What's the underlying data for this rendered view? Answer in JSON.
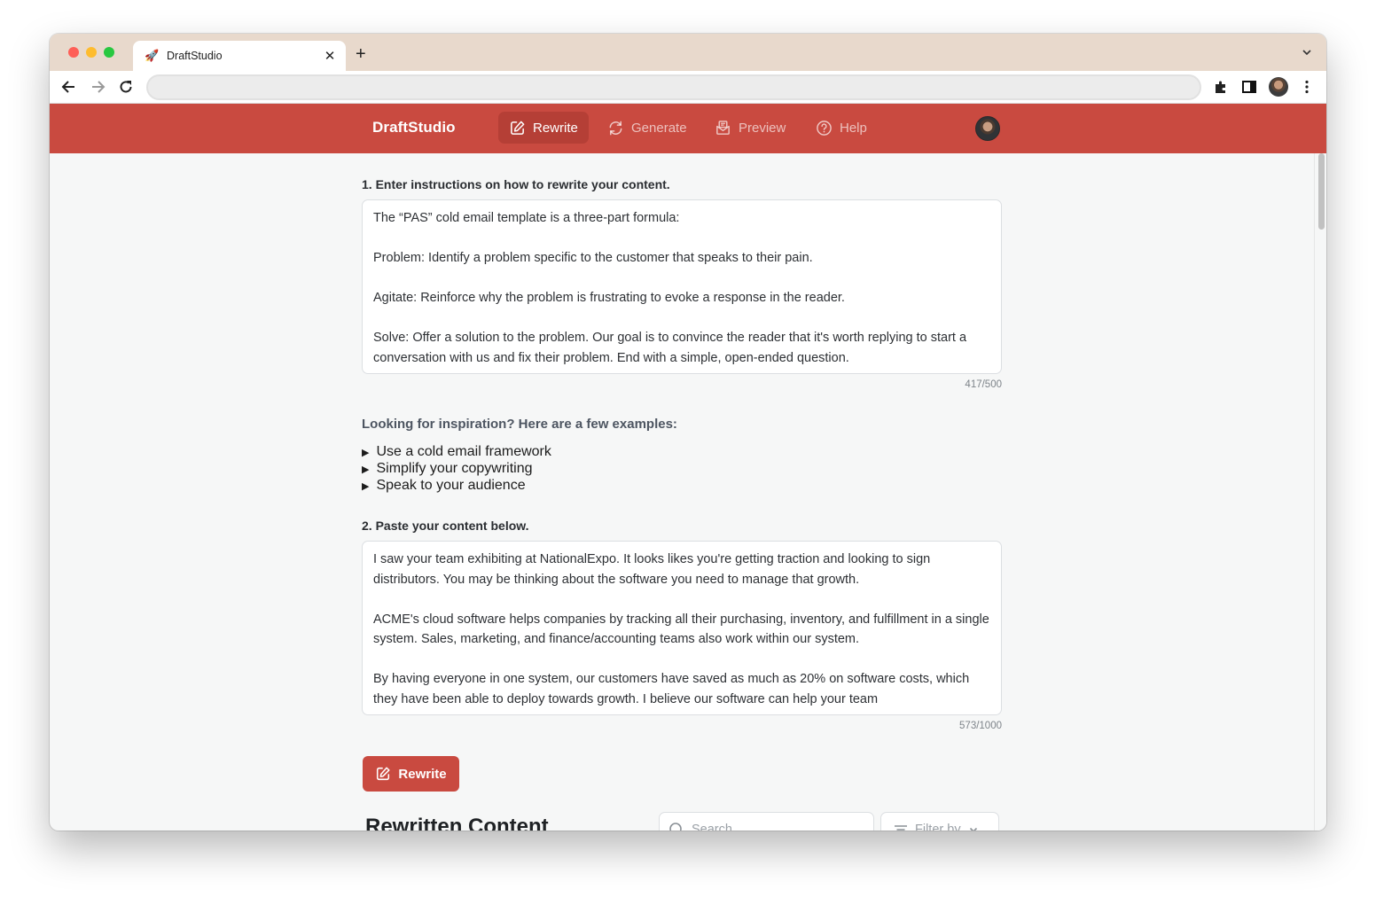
{
  "browser": {
    "tab_title": "DraftStudio",
    "tab_favicon": "🚀",
    "new_tab_label": "+",
    "close_label": "✕",
    "address": ""
  },
  "header": {
    "brand": "DraftStudio",
    "nav": [
      {
        "label": "Rewrite",
        "icon": "edit-icon",
        "active": true
      },
      {
        "label": "Generate",
        "icon": "refresh-icon",
        "active": false
      },
      {
        "label": "Preview",
        "icon": "mail-preview-icon",
        "active": false
      },
      {
        "label": "Help",
        "icon": "help-circle-icon",
        "active": false
      }
    ]
  },
  "step1": {
    "label": "1. Enter instructions on how to rewrite your content.",
    "value": "The “PAS” cold email template is a three-part formula:\n\nProblem: Identify a problem specific to the customer that speaks to their pain.\n\nAgitate: Reinforce why the problem is frustrating to evoke a response in the reader.\n\nSolve: Offer a solution to the problem. Our goal is to convince the reader that it's worth replying to start a conversation with us and fix their problem. End with a simple, open-ended question.",
    "counter": "417/500"
  },
  "inspiration": {
    "title": "Looking for inspiration? Here are a few examples:",
    "examples": [
      "Use a cold email framework",
      "Simplify your copywriting",
      "Speak to your audience"
    ]
  },
  "step2": {
    "label": "2. Paste your content below.",
    "value": "I saw your team exhibiting at NationalExpo. It looks likes you're getting traction and looking to sign distributors. You may be thinking about the software you need to manage that growth.\n\nACME's cloud software helps companies by tracking all their purchasing, inventory, and fulfillment in a single system. Sales, marketing, and finance/accounting teams also work within our system.\n\nBy having everyone in one system, our customers have saved as much as 20% on software costs, which they have been able to deploy towards growth. I believe our software can help your team",
    "counter": "573/1000"
  },
  "actions": {
    "rewrite_label": "Rewrite"
  },
  "results": {
    "title": "Rewritten Content",
    "search_placeholder": "Search",
    "filter_label": "Filter by"
  },
  "colors": {
    "brand": "#c94a40",
    "brand_active": "#b53f36",
    "background": "#f6f7f7"
  }
}
